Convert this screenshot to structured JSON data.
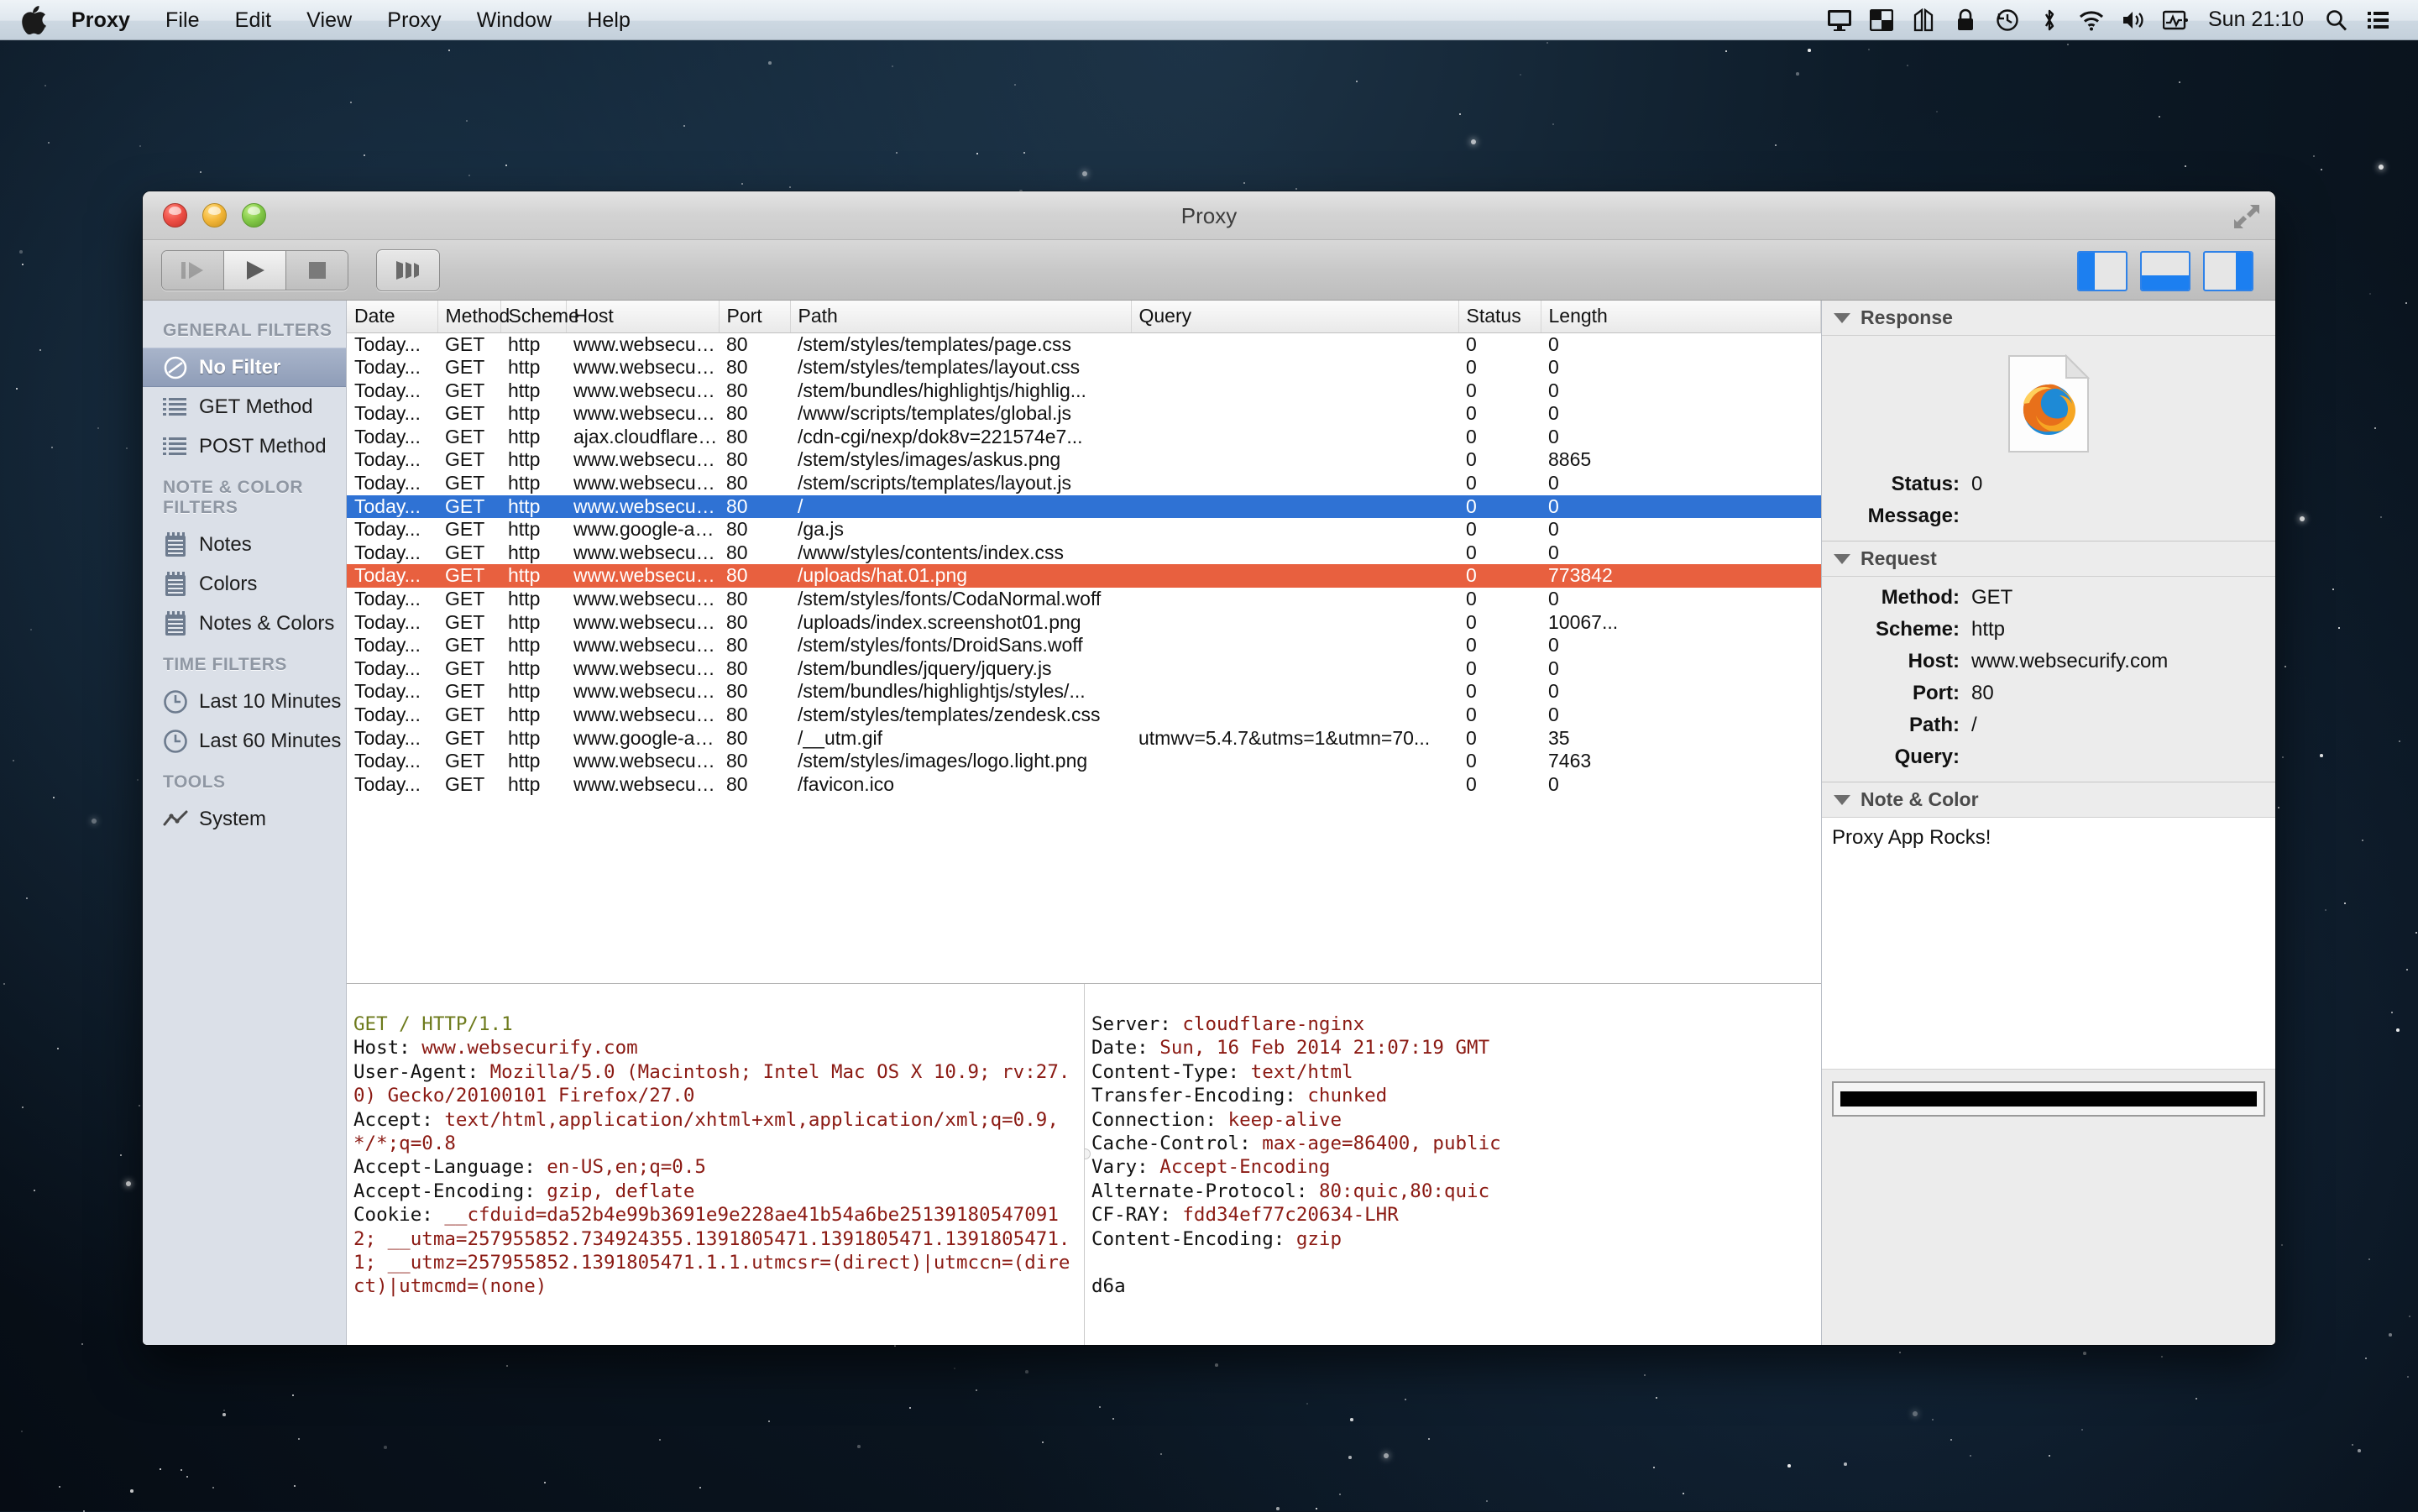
{
  "menubar": {
    "apple_icon": "apple-logo-icon",
    "items": [
      {
        "label": "Proxy",
        "bold": true
      },
      {
        "label": "File",
        "bold": false
      },
      {
        "label": "Edit",
        "bold": false
      },
      {
        "label": "View",
        "bold": false
      },
      {
        "label": "Proxy",
        "bold": false
      },
      {
        "label": "Window",
        "bold": false
      },
      {
        "label": "Help",
        "bold": false
      }
    ],
    "status_icons": [
      "display-icon",
      "mission-control-icon",
      "column-view-icon",
      "lock-icon",
      "time-machine-icon",
      "bluetooth-icon",
      "wifi-icon",
      "volume-icon",
      "activity-icon"
    ],
    "clock": "Sun 21:10",
    "search_icon": "search-icon",
    "notifications_icon": "notification-center-icon"
  },
  "window": {
    "title": "Proxy",
    "fullscreen_icon": "fullscreen-expand-icon",
    "traffic_lights": [
      "close-button",
      "minimize-button",
      "zoom-button"
    ]
  },
  "toolbar": {
    "buttons": [
      {
        "name": "step-button",
        "icon": "step-forward-icon",
        "state": "disabled"
      },
      {
        "name": "play-button",
        "icon": "play-icon",
        "state": "active"
      },
      {
        "name": "stop-button",
        "icon": "stop-square-icon",
        "state": "normal"
      }
    ],
    "extra_button": {
      "name": "columns-button",
      "icon": "columns-icon"
    },
    "view_toggles": [
      {
        "name": "toggle-sidebar",
        "icon": "layout-left-icon"
      },
      {
        "name": "toggle-bottom-panel",
        "icon": "layout-bottom-icon"
      },
      {
        "name": "toggle-inspector",
        "icon": "layout-right-icon"
      }
    ]
  },
  "sidebar": {
    "sections": [
      {
        "heading": "GENERAL FILTERS",
        "items": [
          {
            "label": "No Filter",
            "icon": "no-filter-icon",
            "selected": true
          },
          {
            "label": "GET Method",
            "icon": "list-icon",
            "selected": false
          },
          {
            "label": "POST Method",
            "icon": "list-icon",
            "selected": false
          }
        ]
      },
      {
        "heading": "NOTE & COLOR FILTERS",
        "items": [
          {
            "label": "Notes",
            "icon": "notepad-icon",
            "selected": false
          },
          {
            "label": "Colors",
            "icon": "notepad-icon",
            "selected": false
          },
          {
            "label": "Notes & Colors",
            "icon": "notepad-icon",
            "selected": false
          }
        ]
      },
      {
        "heading": "TIME FILTERS",
        "items": [
          {
            "label": "Last 10 Minutes",
            "icon": "clock-icon",
            "selected": false
          },
          {
            "label": "Last 60 Minutes",
            "icon": "clock-icon",
            "selected": false
          }
        ]
      },
      {
        "heading": "TOOLS",
        "items": [
          {
            "label": "System",
            "icon": "chart-line-icon",
            "selected": false
          }
        ]
      }
    ]
  },
  "table": {
    "columns": [
      "Date",
      "Method",
      "Scheme",
      "Host",
      "Port",
      "Path",
      "Query",
      "Status",
      "Length"
    ],
    "rows": [
      {
        "date": "Today...",
        "method": "GET",
        "scheme": "http",
        "host": "www.websecuri...",
        "port": "80",
        "path": "/stem/styles/templates/page.css",
        "query": "",
        "status": "0",
        "length": "0",
        "state": "normal"
      },
      {
        "date": "Today...",
        "method": "GET",
        "scheme": "http",
        "host": "www.websecuri...",
        "port": "80",
        "path": "/stem/styles/templates/layout.css",
        "query": "",
        "status": "0",
        "length": "0",
        "state": "normal"
      },
      {
        "date": "Today...",
        "method": "GET",
        "scheme": "http",
        "host": "www.websecuri...",
        "port": "80",
        "path": "/stem/bundles/highlightjs/highlig...",
        "query": "",
        "status": "0",
        "length": "0",
        "state": "normal"
      },
      {
        "date": "Today...",
        "method": "GET",
        "scheme": "http",
        "host": "www.websecuri...",
        "port": "80",
        "path": "/www/scripts/templates/global.js",
        "query": "",
        "status": "0",
        "length": "0",
        "state": "normal"
      },
      {
        "date": "Today...",
        "method": "GET",
        "scheme": "http",
        "host": "ajax.cloudflare....",
        "port": "80",
        "path": "/cdn-cgi/nexp/dok8v=221574e7...",
        "query": "",
        "status": "0",
        "length": "0",
        "state": "normal"
      },
      {
        "date": "Today...",
        "method": "GET",
        "scheme": "http",
        "host": "www.websecuri...",
        "port": "80",
        "path": "/stem/styles/images/askus.png",
        "query": "",
        "status": "0",
        "length": "8865",
        "state": "normal"
      },
      {
        "date": "Today...",
        "method": "GET",
        "scheme": "http",
        "host": "www.websecuri...",
        "port": "80",
        "path": "/stem/scripts/templates/layout.js",
        "query": "",
        "status": "0",
        "length": "0",
        "state": "normal"
      },
      {
        "date": "Today...",
        "method": "GET",
        "scheme": "http",
        "host": "www.websecuri...",
        "port": "80",
        "path": "/",
        "query": "",
        "status": "0",
        "length": "0",
        "state": "selected"
      },
      {
        "date": "Today...",
        "method": "GET",
        "scheme": "http",
        "host": "www.google-an...",
        "port": "80",
        "path": "/ga.js",
        "query": "",
        "status": "0",
        "length": "0",
        "state": "normal"
      },
      {
        "date": "Today...",
        "method": "GET",
        "scheme": "http",
        "host": "www.websecuri...",
        "port": "80",
        "path": "/www/styles/contents/index.css",
        "query": "",
        "status": "0",
        "length": "0",
        "state": "normal"
      },
      {
        "date": "Today...",
        "method": "GET",
        "scheme": "http",
        "host": "www.websecuri...",
        "port": "80",
        "path": "/uploads/hat.01.png",
        "query": "",
        "status": "0",
        "length": "773842",
        "state": "noted"
      },
      {
        "date": "Today...",
        "method": "GET",
        "scheme": "http",
        "host": "www.websecuri...",
        "port": "80",
        "path": "/stem/styles/fonts/CodaNormal.woff",
        "query": "",
        "status": "0",
        "length": "0",
        "state": "normal"
      },
      {
        "date": "Today...",
        "method": "GET",
        "scheme": "http",
        "host": "www.websecuri...",
        "port": "80",
        "path": "/uploads/index.screenshot01.png",
        "query": "",
        "status": "0",
        "length": "10067...",
        "state": "normal"
      },
      {
        "date": "Today...",
        "method": "GET",
        "scheme": "http",
        "host": "www.websecuri...",
        "port": "80",
        "path": "/stem/styles/fonts/DroidSans.woff",
        "query": "",
        "status": "0",
        "length": "0",
        "state": "normal"
      },
      {
        "date": "Today...",
        "method": "GET",
        "scheme": "http",
        "host": "www.websecuri...",
        "port": "80",
        "path": "/stem/bundles/jquery/jquery.js",
        "query": "",
        "status": "0",
        "length": "0",
        "state": "normal"
      },
      {
        "date": "Today...",
        "method": "GET",
        "scheme": "http",
        "host": "www.websecuri...",
        "port": "80",
        "path": "/stem/bundles/highlightjs/styles/...",
        "query": "",
        "status": "0",
        "length": "0",
        "state": "normal"
      },
      {
        "date": "Today...",
        "method": "GET",
        "scheme": "http",
        "host": "www.websecuri...",
        "port": "80",
        "path": "/stem/styles/templates/zendesk.css",
        "query": "",
        "status": "0",
        "length": "0",
        "state": "normal"
      },
      {
        "date": "Today...",
        "method": "GET",
        "scheme": "http",
        "host": "www.google-an...",
        "port": "80",
        "path": "/__utm.gif",
        "query": "utmwv=5.4.7&utms=1&utmn=70...",
        "status": "0",
        "length": "35",
        "state": "normal"
      },
      {
        "date": "Today...",
        "method": "GET",
        "scheme": "http",
        "host": "www.websecuri...",
        "port": "80",
        "path": "/stem/styles/images/logo.light.png",
        "query": "",
        "status": "0",
        "length": "7463",
        "state": "normal"
      },
      {
        "date": "Today...",
        "method": "GET",
        "scheme": "http",
        "host": "www.websecuri...",
        "port": "80",
        "path": "/favicon.ico",
        "query": "",
        "status": "0",
        "length": "0",
        "state": "normal"
      }
    ]
  },
  "request_pane": {
    "lines": [
      [
        [
          "g",
          "GET / HTTP/1.1"
        ]
      ],
      [
        [
          "k",
          "Host: "
        ],
        [
          "v",
          "www.websecurify.com"
        ]
      ],
      [
        [
          "k",
          "User-Agent: "
        ],
        [
          "v",
          "Mozilla/5.0 (Macintosh; Intel Mac OS X 10.9; rv:27.0) Gecko/20100101 Firefox/27.0"
        ]
      ],
      [
        [
          "k",
          "Accept: "
        ],
        [
          "v",
          "text/html,application/xhtml+xml,application/xml;q=0.9,*/*;q=0.8"
        ]
      ],
      [
        [
          "k",
          "Accept-Language: "
        ],
        [
          "v",
          "en-US,en;q=0.5"
        ]
      ],
      [
        [
          "k",
          "Accept-Encoding: "
        ],
        [
          "v",
          "gzip, deflate"
        ]
      ],
      [
        [
          "k",
          "Cookie: "
        ],
        [
          "v",
          "__cfduid=da52b4e99b3691e9e228ae41b54a6be251391805470912; __utma=257955852.734924355.1391805471.1391805471.1391805471.1; __utmz=257955852.1391805471.1.1.utmcsr=(direct)|utmccn=(direct)|utmcmd=(none)"
        ]
      ]
    ]
  },
  "response_pane": {
    "lines": [
      [
        [
          "k",
          "Server: "
        ],
        [
          "v",
          "cloudflare-nginx"
        ]
      ],
      [
        [
          "k",
          "Date: "
        ],
        [
          "v",
          "Sun, 16 Feb 2014 21:07:19 GMT"
        ]
      ],
      [
        [
          "k",
          "Content-Type: "
        ],
        [
          "v",
          "text/html"
        ]
      ],
      [
        [
          "k",
          "Transfer-Encoding: "
        ],
        [
          "v",
          "chunked"
        ]
      ],
      [
        [
          "k",
          "Connection: "
        ],
        [
          "v",
          "keep-alive"
        ]
      ],
      [
        [
          "k",
          "Cache-Control: "
        ],
        [
          "v",
          "max-age=86400, public"
        ]
      ],
      [
        [
          "k",
          "Vary: "
        ],
        [
          "v",
          "Accept-Encoding"
        ]
      ],
      [
        [
          "k",
          "Alternate-Protocol: "
        ],
        [
          "v",
          "80:quic,80:quic"
        ]
      ],
      [
        [
          "k",
          "CF-RAY: "
        ],
        [
          "v",
          "fdd34ef77c20634-LHR"
        ]
      ],
      [
        [
          "k",
          "Content-Encoding: "
        ],
        [
          "v",
          "gzip"
        ]
      ],
      [
        [
          "k",
          ""
        ]
      ],
      [
        [
          "k",
          "d6a"
        ]
      ]
    ]
  },
  "inspector": {
    "response": {
      "heading": "Response",
      "icon": "firefox-document-icon",
      "fields": [
        {
          "key": "Status:",
          "value": "0"
        },
        {
          "key": "Message:",
          "value": ""
        }
      ]
    },
    "request": {
      "heading": "Request",
      "fields": [
        {
          "key": "Method:",
          "value": "GET"
        },
        {
          "key": "Scheme:",
          "value": "http"
        },
        {
          "key": "Host:",
          "value": "www.websecurify.com"
        },
        {
          "key": "Port:",
          "value": "80"
        },
        {
          "key": "Path:",
          "value": "/"
        },
        {
          "key": "Query:",
          "value": ""
        }
      ]
    },
    "note_color": {
      "heading": "Note & Color",
      "note_text": "Proxy App Rocks!",
      "swatch_color": "#000000"
    }
  },
  "colors": {
    "selection_blue": "#2f72d4",
    "note_orange": "#e8603f",
    "sidebar_bg": "#dbe0e8",
    "header_value_red": "#8b1a13",
    "header_green": "#6d7a1c"
  }
}
